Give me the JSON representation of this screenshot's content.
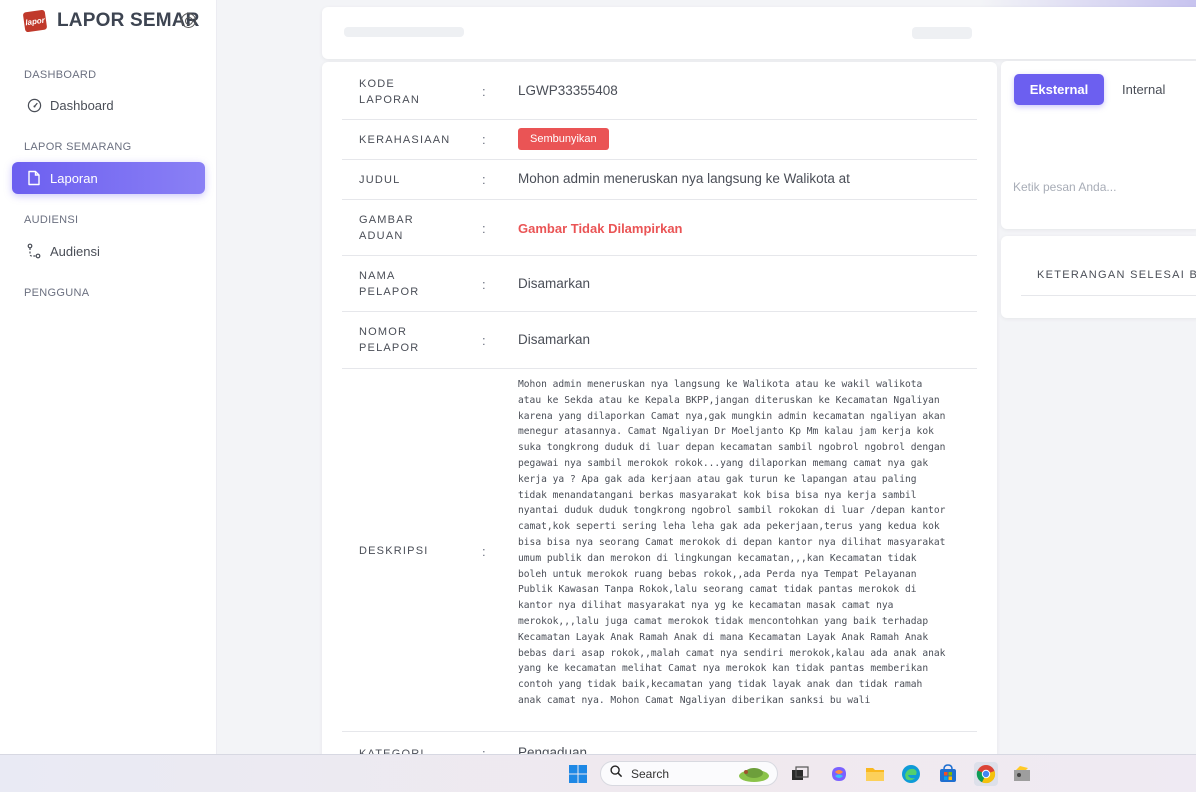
{
  "brand": {
    "title": "LAPOR SEMAR",
    "logo_text": "lapor"
  },
  "sidebar": {
    "sections": [
      {
        "title": "DASHBOARD",
        "items": [
          {
            "label": "Dashboard",
            "icon": "gauge-icon"
          }
        ]
      },
      {
        "title": "LAPOR SEMARANG",
        "items": [
          {
            "label": "Laporan",
            "icon": "document-icon",
            "active": true
          }
        ]
      },
      {
        "title": "AUDIENSI",
        "items": [
          {
            "label": "Audiensi",
            "icon": "route-icon"
          }
        ]
      },
      {
        "title": "PENGGUNA",
        "items": []
      }
    ]
  },
  "report": {
    "kode": {
      "label": "KODE LAPORAN",
      "value": "LGWP33355408"
    },
    "kerahasiaan": {
      "label": "KERAHASIAAN",
      "value": "Sembunyikan"
    },
    "judul": {
      "label": "JUDUL",
      "value": "Mohon admin meneruskan nya langsung ke Walikota at"
    },
    "gambar": {
      "label": "GAMBAR ADUAN",
      "value": "Gambar Tidak Dilampirkan"
    },
    "nama": {
      "label": "NAMA PELAPOR",
      "value": "Disamarkan"
    },
    "nomor": {
      "label": "NOMOR PELAPOR",
      "value": "Disamarkan"
    },
    "deskripsi": {
      "label": "DESKRIPSI",
      "value": "Mohon admin meneruskan nya langsung ke Walikota atau ke wakil walikota\natau ke Sekda atau ke Kepala BKPP,jangan diteruskan ke Kecamatan Ngaliyan\nkarena yang dilaporkan Camat nya,gak mungkin admin kecamatan ngaliyan akan\nmenegur atasannya. Camat Ngaliyan Dr Moeljanto Kp Mm kalau jam kerja kok\nsuka tongkrong duduk di luar depan kecamatan sambil ngobrol ngobrol dengan\npegawai nya sambil merokok rokok...yang dilaporkan memang camat nya gak\nkerja ya ? Apa gak ada kerjaan atau gak turun ke lapangan atau paling\ntidak menandatangani berkas masyarakat kok bisa bisa nya kerja sambil\nnyantai duduk duduk tongkrong ngobrol sambil rokokan di luar /depan kantor\ncamat,kok seperti sering leha leha gak ada pekerjaan,terus yang kedua kok\nbisa bisa nya seorang Camat merokok di depan kantor nya dilihat masyarakat\numum publik dan merokon di lingkungan kecamatan,,,kan Kecamatan tidak\nboleh untuk merokok ruang bebas rokok,,ada Perda nya Tempat Pelayanan\nPublik Kawasan Tanpa Rokok,lalu seorang camat tidak pantas merokok di\nkantor nya dilihat masyarakat nya yg ke kecamatan masak camat nya\nmerokok,,,lalu juga camat merokok tidak mencontohkan yang baik terhadap\nKecamatan Layak Anak Ramah Anak di mana Kecamatan Layak Anak Ramah Anak\nbebas dari asap rokok,,malah camat nya sendiri merokok,kalau ada anak anak\nyang ke kecamatan melihat Camat nya merokok kan tidak pantas memberikan\ncontoh yang tidak baik,kecamatan yang tidak layak anak dan tidak ramah\nanak camat nya. Mohon Camat Ngaliyan diberikan sanksi bu wali"
    },
    "kategori": {
      "label": "KATEGORI",
      "value": "Pengaduan"
    },
    "colon": ":"
  },
  "chat": {
    "tab_external": "Eksternal",
    "tab_internal": "Internal",
    "placeholder": "Ketik pesan Anda..."
  },
  "keterangan": {
    "title": "KETERANGAN SELESAI BE"
  },
  "taskbar": {
    "search_label": "Search"
  },
  "colors": {
    "accent": "#6c5ff0",
    "danger": "#ea5455"
  }
}
